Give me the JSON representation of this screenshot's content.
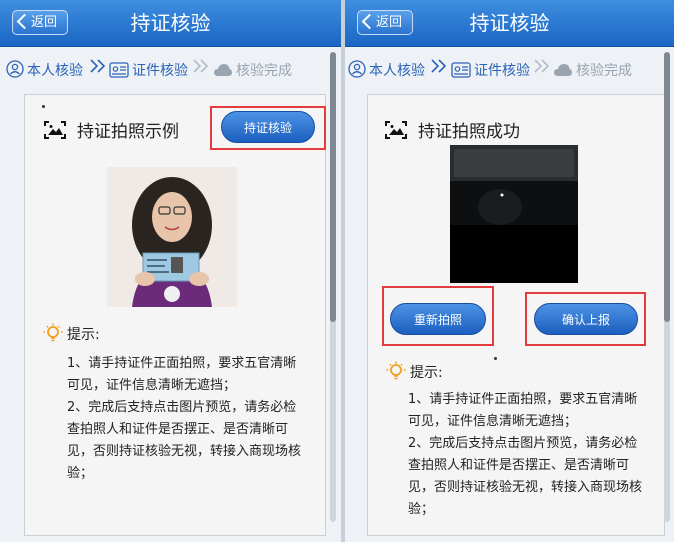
{
  "left": {
    "back_label": "返回",
    "title": "持证核验",
    "steps": [
      "本人核验",
      "证件核验",
      "核验完成"
    ],
    "section_title": "持证拍照示例",
    "button_label": "持证核验",
    "tip_title": "提示:",
    "tips": [
      "1、请手持证件正面拍照，要求五官清晰可见，证件信息清晰无遮挡；",
      "2、完成后支持点击图片预览，请务必检查拍照人和证件是否摆正、是否清晰可见，否则持证核验无视，转接入商现场核验；"
    ]
  },
  "right": {
    "back_label": "返回",
    "title": "持证核验",
    "steps": [
      "本人核验",
      "证件核验",
      "核验完成"
    ],
    "section_title": "持证拍照成功",
    "retake_label": "重新拍照",
    "confirm_label": "确认上报",
    "tip_title": "提示:",
    "tips": [
      "1、请手持证件正面拍照，要求五官清晰可见，证件信息清晰无遮挡；",
      "2、完成后支持点击图片预览，请务必检查拍照人和证件是否摆正、是否清晰可见，否则持证核验无视，转接入商现场核验；"
    ]
  },
  "colors": {
    "header": "#1a66c4",
    "button": "#1c5fbf",
    "highlight": "#e43c3c",
    "step_active": "#2b63b8",
    "step_inactive": "#9aa4b0"
  }
}
